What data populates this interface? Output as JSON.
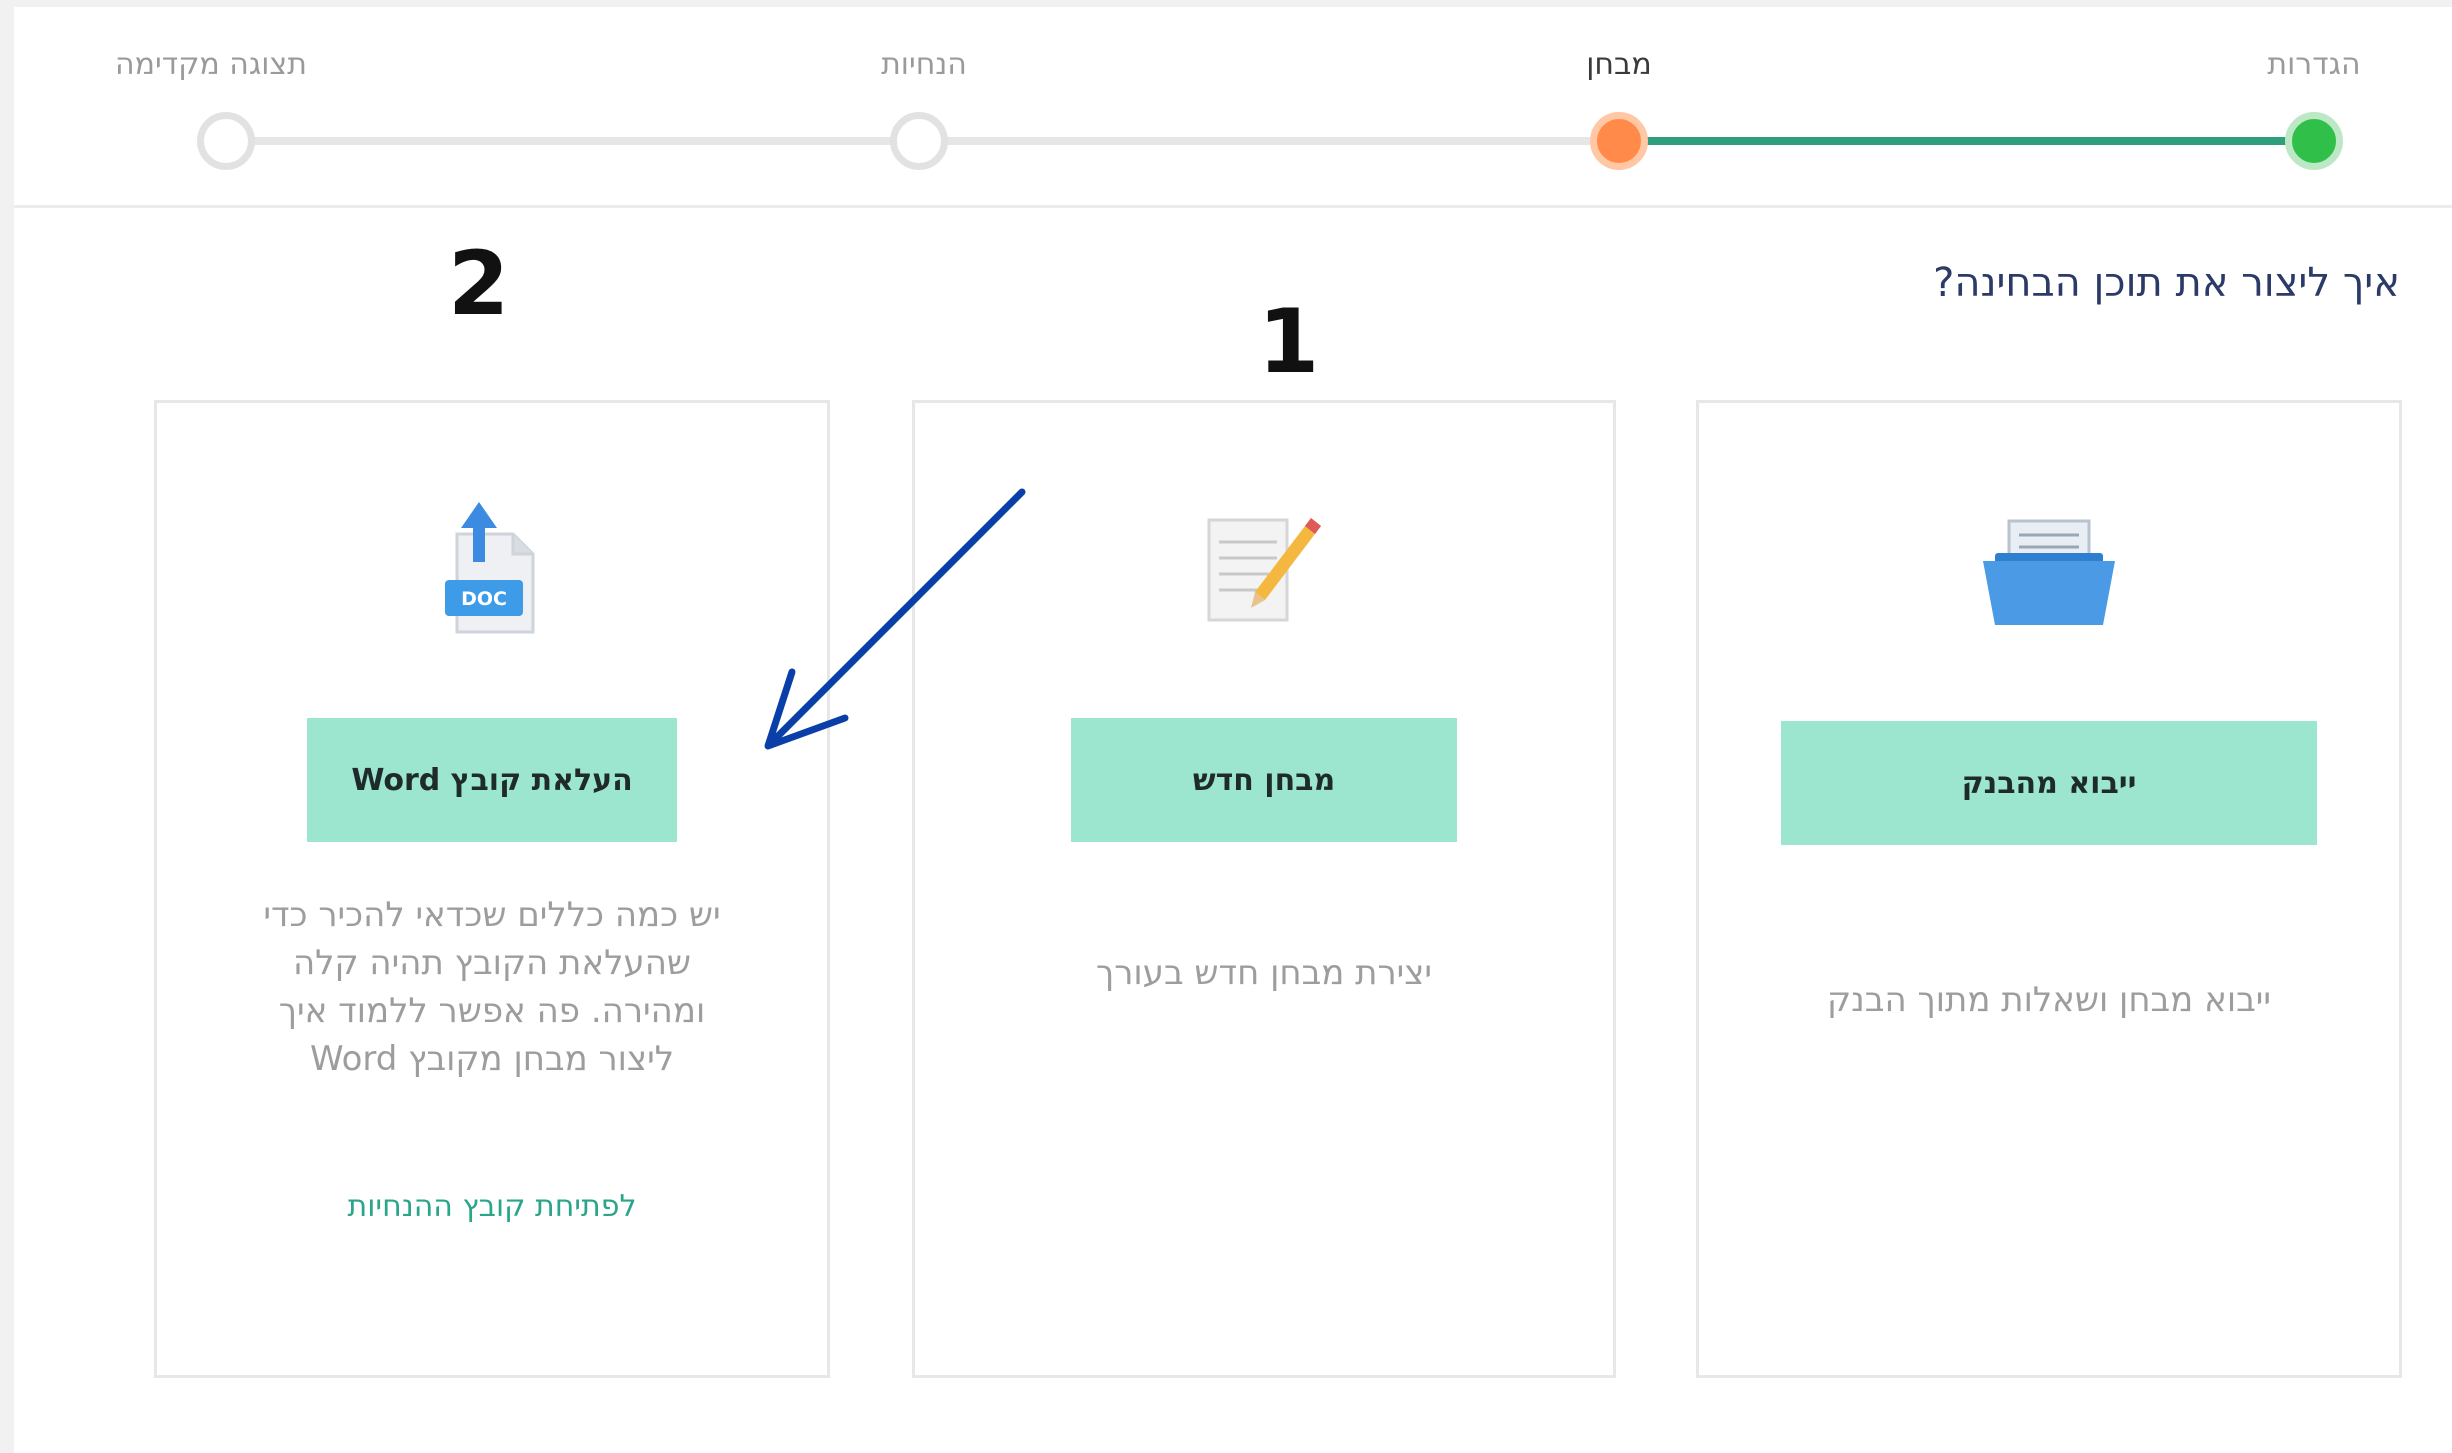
{
  "steps": [
    {
      "label": "הגדרות",
      "state": "done"
    },
    {
      "label": "מבחן",
      "state": "current"
    },
    {
      "label": "הנחיות",
      "state": "todo"
    },
    {
      "label": "תצוגה מקדימה",
      "state": "todo"
    }
  ],
  "question": "איך ליצור את תוכן הבחינה?",
  "markers": {
    "one": "1",
    "two": "2"
  },
  "cards": {
    "import": {
      "button": "ייבוא מהבנק",
      "description": "ייבוא מבחן ושאלות מתוך הבנק",
      "icon": "folder-icon"
    },
    "new": {
      "button": "מבחן חדש",
      "description": "יצירת מבחן חדש בעורך",
      "icon": "notepad-pencil-icon"
    },
    "word": {
      "button": "העלאת קובץ Word",
      "description": [
        "יש כמה כללים שכדאי להכיר כדי",
        "שהעלאת הקובץ תהיה קלה",
        "ומהירה. פה אפשר ללמוד איך",
        "ליצור מבחן מקובץ Word"
      ],
      "link": "לפתיחת קובץ ההנחיות",
      "icon_text": "DOC",
      "icon": "doc-upload-icon"
    }
  },
  "colors": {
    "accent_button": "#9ce6d0",
    "done_step": "#30c04a",
    "current_step": "#ff8a4a",
    "link": "#2ba58a",
    "annotation_arrow": "#0a3fa8"
  }
}
